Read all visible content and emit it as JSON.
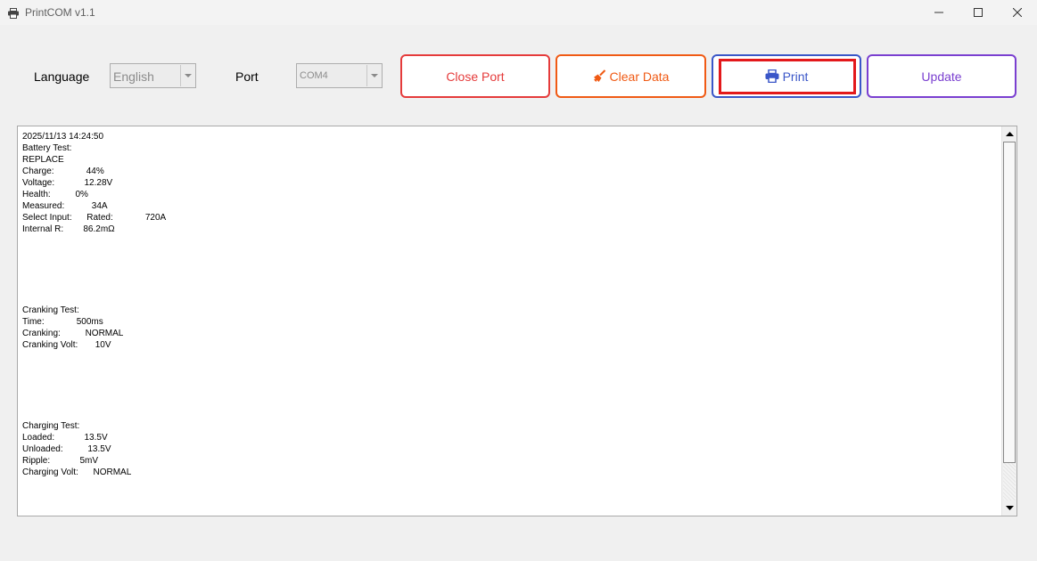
{
  "window": {
    "title": "PrintCOM v1.1",
    "icons": {
      "app": "printer-icon",
      "minimize": "minimize-icon",
      "maximize": "maximize-icon",
      "close": "close-icon"
    }
  },
  "toolbar": {
    "language_label": "Language",
    "language_value": "English",
    "port_label": "Port",
    "port_value": "COM4",
    "close_port_label": "Close Port",
    "clear_data_label": "Clear Data",
    "print_label": "Print",
    "update_label": "Update"
  },
  "colors": {
    "close_port": "#e53b3b",
    "clear_data": "#f05a14",
    "print": "#3a56c8",
    "update": "#7a3fd0",
    "highlight": "#e3181b"
  },
  "output": {
    "text": "2025/11/13 14:24:50\nBattery Test:\nREPLACE\nCharge:             44%\nVoltage:            12.28V\nHealth:          0%\nMeasured:           34A\nSelect Input:      Rated:             720A\nInternal R:        86.2mΩ\n\n\n\n\n\n\nCranking Test:\nTime:             500ms\nCranking:          NORMAL\nCranking Volt:       10V\n\n\n\n\n\n\nCharging Test:\nLoaded:            13.5V\nUnloaded:          13.5V\nRipple:            5mV\nCharging Volt:      NORMAL"
  }
}
